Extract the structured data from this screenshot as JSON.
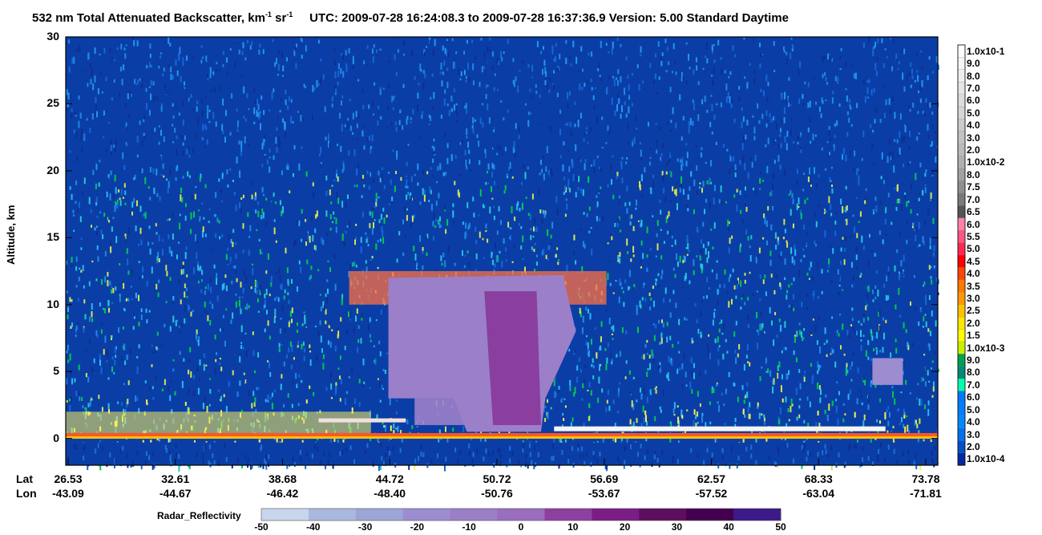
{
  "title": {
    "main": "532 nm Total Attenuated Backscatter, km",
    "exp1": "-1",
    "mid": " sr",
    "exp2": "-1",
    "utc": "UTC:  2009-07-28 16:24:08.3  to  2009-07-28 16:37:36.9    Version: 5.00  Standard  Daytime"
  },
  "chart_data": [
    {
      "type": "heatmap",
      "title": "532 nm Total Attenuated Backscatter, km-1 sr-1",
      "ylabel": "Altitude, km",
      "ylim": [
        -2,
        30
      ],
      "yticks": [
        "30",
        "25",
        "20",
        "15",
        "10",
        "5",
        "0"
      ],
      "x_labels": {
        "lat_label": "Lat",
        "lon_label": "Lon",
        "lat": [
          "26.53",
          "32.61",
          "38.68",
          "44.72",
          "50.72",
          "56.69",
          "62.57",
          "68.33",
          "73.78"
        ],
        "lon": [
          "-43.09",
          "-44.67",
          "-46.42",
          "-48.40",
          "-50.76",
          "-53.67",
          "-57.52",
          "-63.04",
          "-71.81"
        ]
      },
      "colorbar": {
        "labels": [
          "1.0x10-1",
          "9.0",
          "8.0",
          "7.0",
          "6.0",
          "5.0",
          "4.0",
          "3.0",
          "2.0",
          "1.0x10-2",
          "8.0",
          "7.5",
          "7.0",
          "6.5",
          "6.0",
          "5.5",
          "5.0",
          "4.5",
          "4.0",
          "3.5",
          "3.0",
          "2.5",
          "2.0",
          "1.5",
          "1.0x10-3",
          "9.0",
          "8.0",
          "7.0",
          "6.0",
          "5.0",
          "4.0",
          "3.0",
          "2.0",
          "1.0x10-4"
        ],
        "colors": [
          "#ffffff",
          "#f5f5f5",
          "#eeeeee",
          "#e6e6e6",
          "#dddddd",
          "#d5d5d5",
          "#cccccc",
          "#c3c3c3",
          "#bbbbbb",
          "#b0b0b0",
          "#a2a2a2",
          "#909090",
          "#7a7a7a",
          "#555555",
          "#ff82a8",
          "#ff5582",
          "#ff2850",
          "#ff0000",
          "#ff4500",
          "#ff7800",
          "#ff9900",
          "#ffc200",
          "#ffe600",
          "#ffff00",
          "#c8f000",
          "#00a050",
          "#008c78",
          "#00ffaa",
          "#0078ff",
          "#0080ff",
          "#0088ff",
          "#0070f0",
          "#0050c8",
          "#002aa0"
        ]
      }
    },
    {
      "type": "heatmap",
      "title": "Radar_Reflectivity",
      "ticks": [
        "-50",
        "-40",
        "-30",
        "-20",
        "-10",
        "0",
        "10",
        "20",
        "30",
        "40",
        "50"
      ],
      "colors": [
        "#c8d6ec",
        "#a9b9dd",
        "#9ba6d6",
        "#9b8dcf",
        "#9a7fc7",
        "#9a6dbf",
        "#8f3fa0",
        "#7a1e86",
        "#5e0e5e",
        "#43004f",
        "#3c1a8a"
      ]
    }
  ]
}
